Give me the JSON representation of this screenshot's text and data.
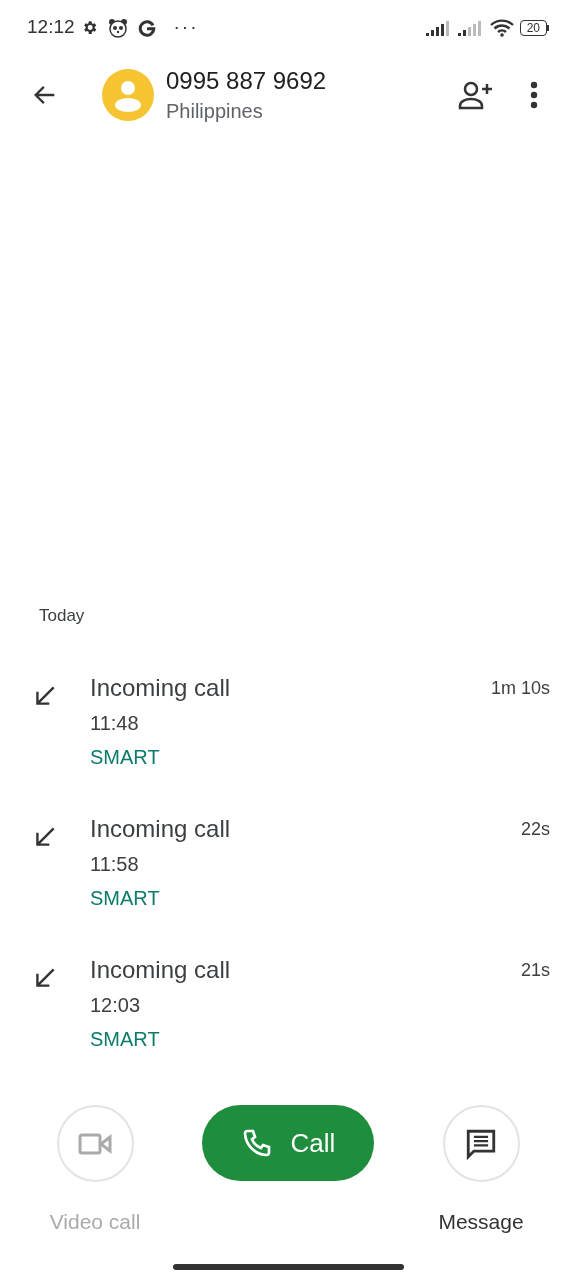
{
  "status_bar": {
    "time": "12:12",
    "more": "···",
    "battery": "20"
  },
  "header": {
    "number": "0995 887 9692",
    "location": "Philippines"
  },
  "section": "Today",
  "calls": [
    {
      "kind": "incoming",
      "title": "Incoming call",
      "time": "11:48",
      "carrier": "SMART",
      "duration": "1m 10s"
    },
    {
      "kind": "incoming",
      "title": "Incoming call",
      "time": "11:58",
      "carrier": "SMART",
      "duration": "22s"
    },
    {
      "kind": "incoming",
      "title": "Incoming call",
      "time": "12:03",
      "carrier": "SMART",
      "duration": "21s"
    }
  ],
  "actions": [
    {
      "kind": "video",
      "label": "Video call",
      "disabled": true
    },
    {
      "kind": "call",
      "label": "Call",
      "disabled": false
    },
    {
      "kind": "message",
      "label": "Message",
      "disabled": false
    }
  ]
}
